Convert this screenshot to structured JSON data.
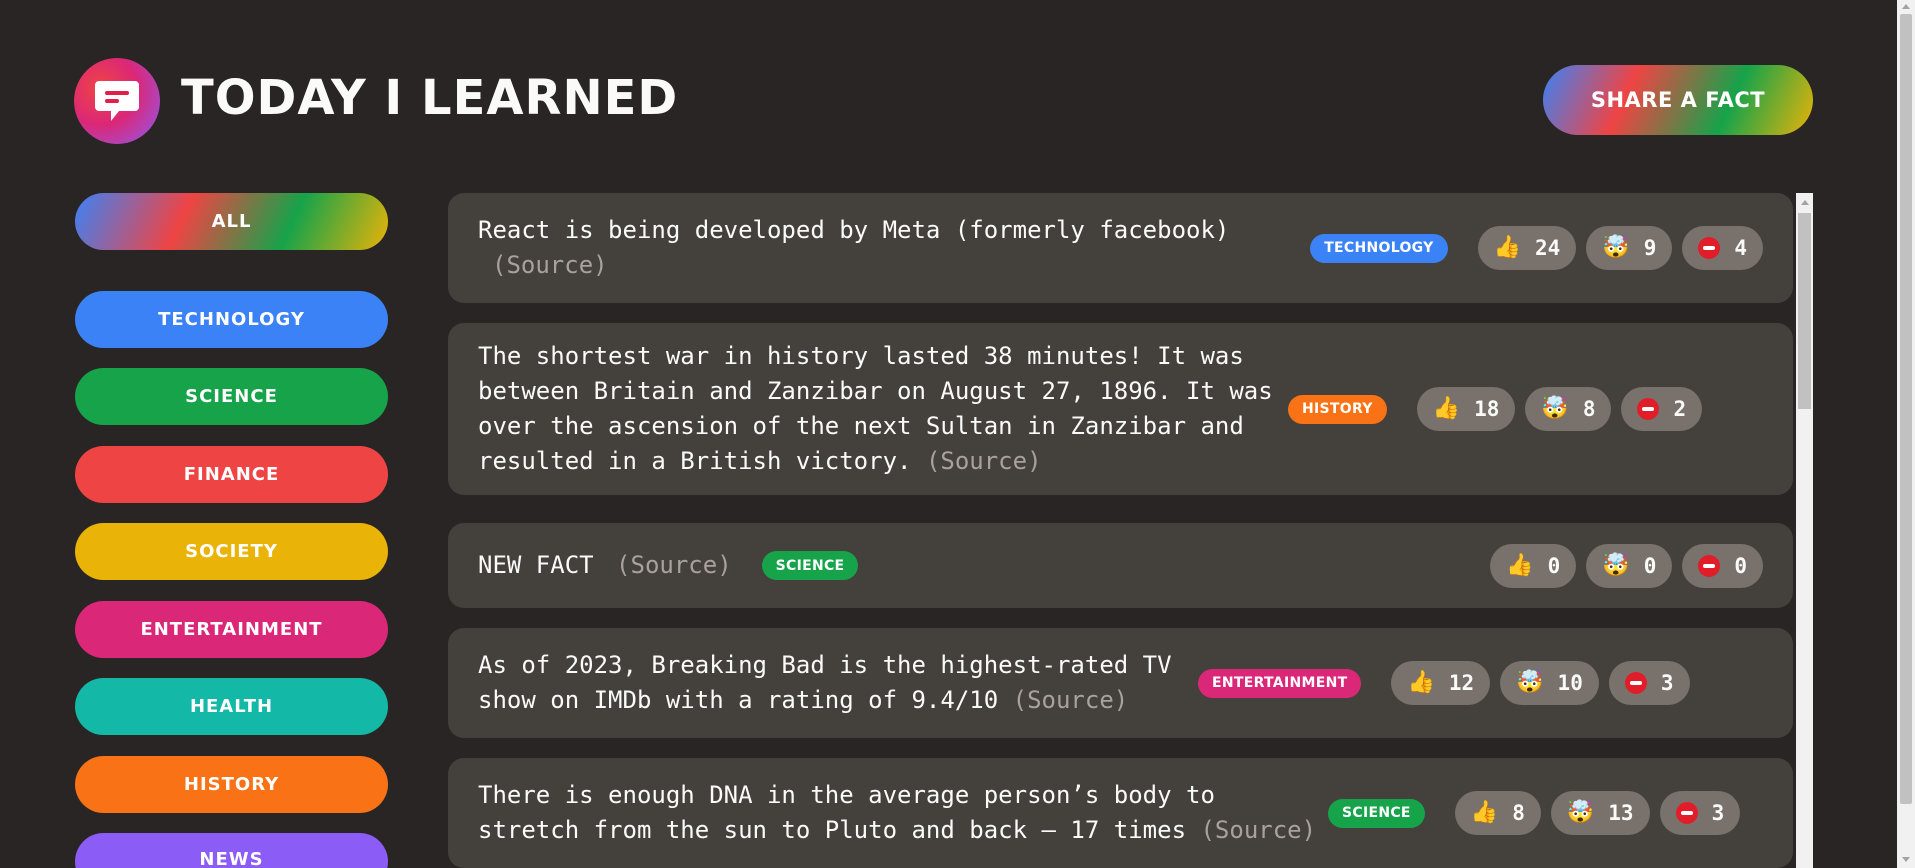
{
  "header": {
    "title": "Today I Learned",
    "share_label": "Share a fact"
  },
  "sidebar": {
    "items": [
      {
        "label": "All",
        "color": "gradient"
      },
      {
        "label": "Technology",
        "color": "#3b82f6"
      },
      {
        "label": "Science",
        "color": "#16a34a"
      },
      {
        "label": "Finance",
        "color": "#ef4444"
      },
      {
        "label": "Society",
        "color": "#eab308"
      },
      {
        "label": "Entertainment",
        "color": "#db2777"
      },
      {
        "label": "Health",
        "color": "#14b8a6"
      },
      {
        "label": "History",
        "color": "#f97316"
      },
      {
        "label": "News",
        "color": "#8b5cf6"
      }
    ]
  },
  "facts": [
    {
      "text": "React is being developed by Meta (formerly facebook)",
      "source": "(Source)",
      "category": "technology",
      "category_color": "#3b82f6",
      "votes": {
        "interesting": "24",
        "mindblowing": "9",
        "false": "4"
      }
    },
    {
      "text": "The shortest war in history lasted 38 minutes! It was between Britain and Zanzibar on August 27, 1896. It was over the ascension of the next Sultan in Zanzibar and resulted in a British victory.",
      "source": "(Source)",
      "category": "history",
      "category_color": "#f97316",
      "votes": {
        "interesting": "18",
        "mindblowing": "8",
        "false": "2"
      }
    },
    {
      "text": "NEW FACT",
      "source": "(Source)",
      "category": "science",
      "category_color": "#16a34a",
      "votes": {
        "interesting": "0",
        "mindblowing": "0",
        "false": "0"
      }
    },
    {
      "text": "As of 2023, Breaking Bad is the highest-rated TV show on IMDb with a rating of 9.4/10",
      "source": "(Source)",
      "category": "entertainment",
      "category_color": "#db2777",
      "votes": {
        "interesting": "12",
        "mindblowing": "10",
        "false": "3"
      }
    },
    {
      "text": "There is enough DNA in the average person’s body to stretch from the sun to Pluto and back — 17 times",
      "source": "(Source)",
      "category": "science",
      "category_color": "#16a34a",
      "votes": {
        "interesting": "8",
        "mindblowing": "13",
        "false": "3"
      }
    }
  ],
  "icons": {
    "interesting": "👍",
    "mindblowing": "🤯",
    "logo": "chat-bubble-icon",
    "false": "minus-circle-icon"
  }
}
